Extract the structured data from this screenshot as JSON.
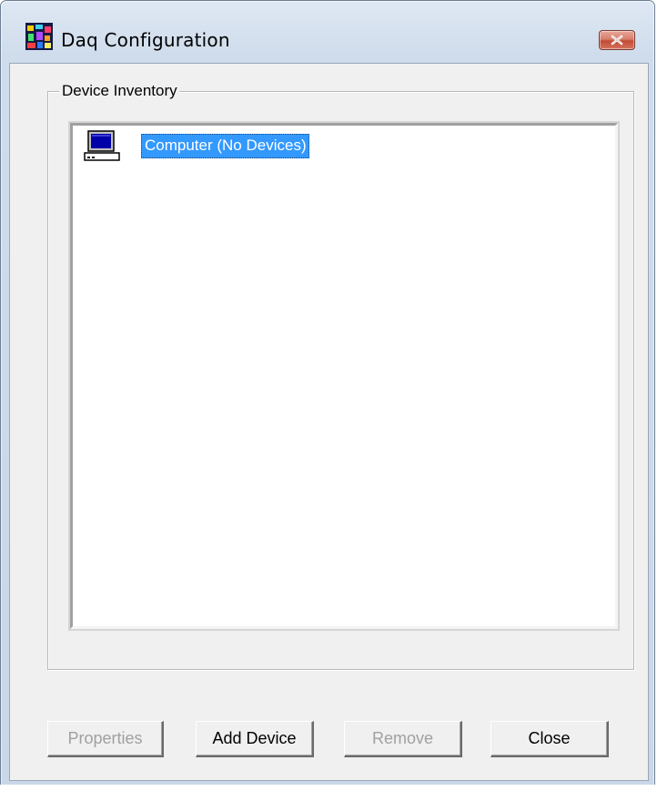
{
  "window": {
    "title": "Daq Configuration",
    "app_icon": "daq-app-icon",
    "close_icon": "close-icon"
  },
  "device_inventory": {
    "group_label": "Device Inventory",
    "items": [
      {
        "label": "Computer (No Devices)",
        "icon": "computer-icon",
        "selected": true
      }
    ]
  },
  "buttons": {
    "properties": "Properties",
    "add_device": "Add Device",
    "remove": "Remove",
    "close": "Close"
  },
  "colors": {
    "selection": "#3399ff",
    "dialog_background": "#f0f0f0",
    "disabled_text": "#a0a0a0"
  }
}
